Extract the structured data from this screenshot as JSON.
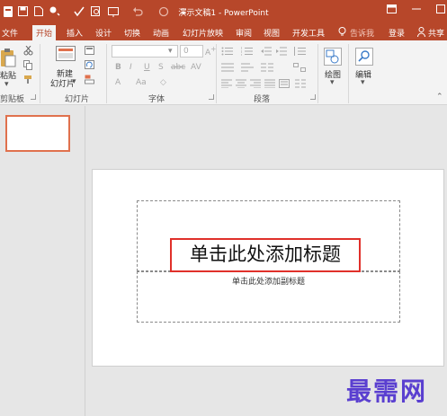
{
  "window": {
    "title": "演示文稿1 - PowerPoint"
  },
  "tabs": [
    "文件",
    "开始",
    "插入",
    "设计",
    "切换",
    "动画",
    "幻灯片放映",
    "审阅",
    "视图",
    "开发工具"
  ],
  "tell_me": "告诉我",
  "account": {
    "login": "登录",
    "share": "共享"
  },
  "ribbon": {
    "clipboard": {
      "paste": "粘贴",
      "label": "剪贴板"
    },
    "slides": {
      "new_slide_line1": "新建",
      "new_slide_line2": "幻灯片",
      "label": "幻灯片"
    },
    "font": {
      "size_value": "0",
      "bold": "B",
      "italic": "I",
      "underline": "U",
      "strike": "S",
      "shadow": "abc",
      "spacing": "AV",
      "font_color": "A",
      "case": "Aa",
      "label": "字体"
    },
    "paragraph": {
      "label": "段落"
    },
    "drawing": {
      "label": "绘图"
    },
    "editing": {
      "label": "编辑"
    }
  },
  "slide": {
    "title_placeholder": "单击此处添加标题",
    "subtitle_placeholder": "单击此处添加副标题"
  },
  "watermark": "最需网",
  "colors": {
    "accent": "#b7472a",
    "highlight": "#e0302a",
    "thumb_border": "#e0714d",
    "watermark": "#5a3fd0"
  }
}
